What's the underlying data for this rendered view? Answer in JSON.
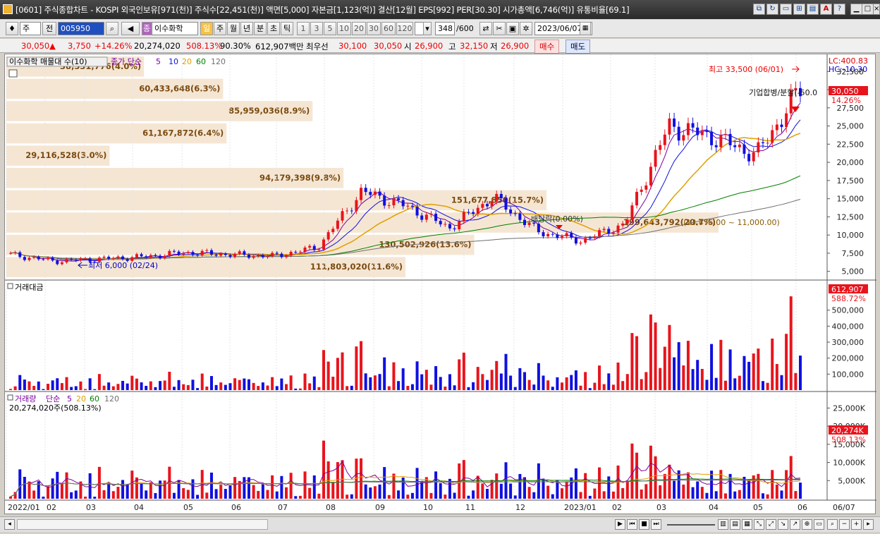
{
  "window": {
    "title": "[0601] 주식종합차트 - KOSPI 외국인보유[971(천)] 주식수[22,451(천)] 액면[5,000] 자본금[1,123(억)] 결산[12월] EPS[992] PER[30.30] 시가총액[6,746(억)] 유통비율[69.1]"
  },
  "toolbar": {
    "period_select": "주",
    "prev_label": "전",
    "code": "005950",
    "name": "이수화학",
    "name_prefix": "종",
    "periods": [
      "일",
      "주",
      "월",
      "년",
      "분",
      "초",
      "틱"
    ],
    "active_period": "일",
    "numbers": [
      "1",
      "3",
      "5",
      "10",
      "20",
      "30",
      "60",
      "120"
    ],
    "count": "348",
    "count_total": "/600",
    "date": "2023/06/07"
  },
  "quote": {
    "price": "30,050",
    "arrow": "▲",
    "change": "3,750",
    "change_pct": "+14.26%",
    "volume": "20,274,020",
    "vol_ratio": "508.13%",
    "turnover": "90.30%",
    "amount": "612,907백만",
    "best_ask_label": "최우선",
    "best_ask": "30,100",
    "best_bid": "30,050",
    "open_label": "시",
    "open": "26,900",
    "high_label": "고",
    "high": "32,150",
    "low_label": "저",
    "low": "26,900",
    "buy_label": "매수",
    "sell_label": "매도"
  },
  "colors": {
    "up": "#e8141c",
    "down": "#1010e0",
    "ma5": "#7a00a0",
    "ma20": "#e0a000",
    "ma60": "#008000",
    "ma120": "#707070",
    "profile": "#f5e6d3"
  },
  "chart_data": [
    {
      "type": "candlestick",
      "title": "",
      "legend": {
        "profile_label": "이수화학 매물대 수(10)",
        "ma_label": "종가 단순",
        "ma_periods": [
          "5",
          "10",
          "20",
          "60",
          "120"
        ]
      },
      "x_ticks": [
        "2022/01",
        "02",
        "03",
        "04",
        "05",
        "06",
        "07",
        "08",
        "09",
        "10",
        "11",
        "12",
        "2023/01",
        "02",
        "03",
        "04",
        "05",
        "06",
        "06/07"
      ],
      "y_ticks": [
        "32,500",
        "30,000",
        "27,500",
        "25,000",
        "22,500",
        "20,000",
        "17,500",
        "15,000",
        "12,500",
        "10,000",
        "7,500",
        "5,000"
      ],
      "ylim": [
        4000,
        33500
      ],
      "lc_label": "LC:400.83",
      "hc_label": "HC:-10.30",
      "price_tag": "30,050",
      "price_pct_tag": "14.26%",
      "high_note": "최고 33,500 (06/01)",
      "low_note": "최저 6,000 (02/24)",
      "dividend_note": "배당락(0.00%)",
      "merger_note": "기업합병/분할(-50.0",
      "range_note": "(13,475.00 ~ 11,000.00)",
      "volume_profile": [
        {
          "label": "38,531,776(4.0%)",
          "pct": 4.0
        },
        {
          "label": "60,433,648(6.3%)",
          "pct": 6.3
        },
        {
          "label": "85,959,036(8.9%)",
          "pct": 8.9
        },
        {
          "label": "61,167,872(6.4%)",
          "pct": 6.4
        },
        {
          "label": "29,116,528(3.0%)",
          "pct": 3.0
        },
        {
          "label": "94,179,398(9.8%)",
          "pct": 9.8
        },
        {
          "label": "151,677,850(15.7%)",
          "pct": 15.7
        },
        {
          "label": "199,643,792(20.7%)",
          "pct": 20.7
        },
        {
          "label": "130,502,926(13.6%)",
          "pct": 13.6
        },
        {
          "label": "111,803,020(11.6%)",
          "pct": 11.6
        }
      ],
      "weekly_close": [
        {
          "m": "2022-01",
          "v": 7300
        },
        {
          "m": "2022-02",
          "v": 6400
        },
        {
          "m": "2022-03",
          "v": 6700
        },
        {
          "m": "2022-04",
          "v": 7000
        },
        {
          "m": "2022-05",
          "v": 7600
        },
        {
          "m": "2022-06",
          "v": 7300
        },
        {
          "m": "2022-07",
          "v": 7100
        },
        {
          "m": "2022-08",
          "v": 8300
        },
        {
          "m": "2022-09a",
          "v": 16000
        },
        {
          "m": "2022-09b",
          "v": 14000
        },
        {
          "m": "2022-10",
          "v": 11000
        },
        {
          "m": "2022-11",
          "v": 15200
        },
        {
          "m": "2022-12",
          "v": 10500
        },
        {
          "m": "2023-01",
          "v": 9200
        },
        {
          "m": "2023-02",
          "v": 11500
        },
        {
          "m": "2023-03",
          "v": 25000
        },
        {
          "m": "2023-04",
          "v": 23500
        },
        {
          "m": "2023-05",
          "v": 21000
        },
        {
          "m": "2023-06",
          "v": 30050
        }
      ]
    },
    {
      "type": "bar",
      "title": "거래대금",
      "y_ticks": [
        "500,000",
        "400,000",
        "300,000",
        "200,000",
        "100,000"
      ],
      "ylim": [
        0,
        600000
      ],
      "value_tag": "612,907",
      "pct_tag": "588.72%"
    },
    {
      "type": "bar",
      "title": "거래량",
      "ma_label": "단순",
      "ma_periods": [
        "5",
        "20",
        "60",
        "120"
      ],
      "info": "20,274,020주(508.13%)",
      "y_ticks": [
        "25,000K",
        "20,000K",
        "15,000K",
        "10,000K",
        "5,000K"
      ],
      "ylim": [
        0,
        28000
      ],
      "value_tag": "20,274K",
      "pct_tag": "508.13%"
    }
  ]
}
